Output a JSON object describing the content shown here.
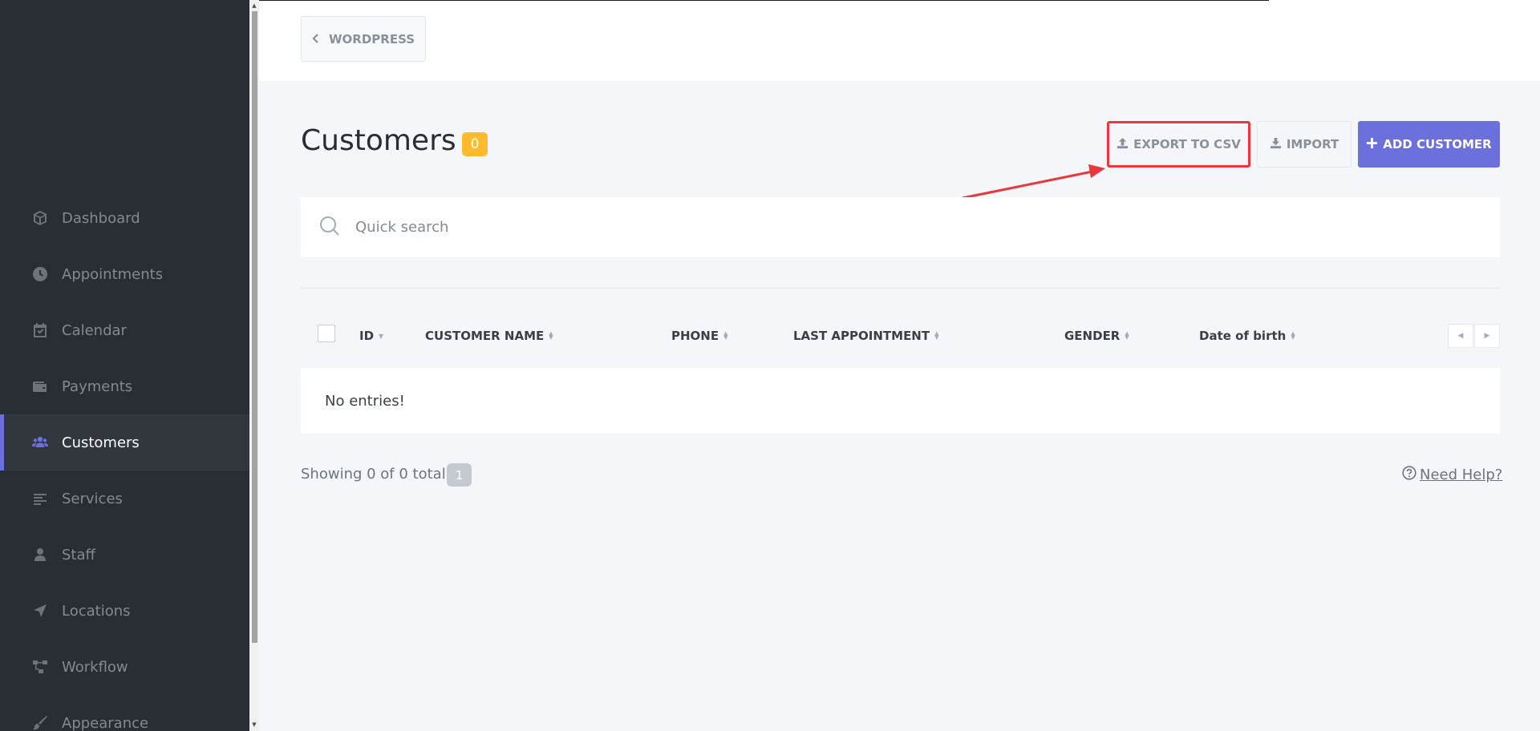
{
  "sidebar": {
    "items": [
      {
        "label": "Dashboard",
        "icon": "box-icon"
      },
      {
        "label": "Appointments",
        "icon": "clock-icon"
      },
      {
        "label": "Calendar",
        "icon": "calendar-icon"
      },
      {
        "label": "Payments",
        "icon": "wallet-icon"
      },
      {
        "label": "Customers",
        "icon": "users-icon",
        "active": true
      },
      {
        "label": "Services",
        "icon": "list-icon"
      },
      {
        "label": "Staff",
        "icon": "user-icon"
      },
      {
        "label": "Locations",
        "icon": "location-arrow-icon"
      },
      {
        "label": "Workflow",
        "icon": "workflow-icon"
      },
      {
        "label": "Appearance",
        "icon": "brush-icon"
      }
    ]
  },
  "topbar": {
    "wordpress_label": "WORDPRESS"
  },
  "page": {
    "title": "Customers",
    "count": "0"
  },
  "actions": {
    "export_label": "EXPORT TO CSV",
    "import_label": "IMPORT",
    "add_label": "ADD CUSTOMER"
  },
  "search": {
    "placeholder": "Quick search"
  },
  "table": {
    "columns": [
      "ID",
      "CUSTOMER NAME",
      "PHONE",
      "LAST APPOINTMENT",
      "GENDER",
      "Date of birth"
    ],
    "empty_text": "No entries!"
  },
  "footer": {
    "showing_text": "Showing 0 of 0 total",
    "page": "1",
    "help_label": "Need Help?"
  },
  "colors": {
    "accent": "#6c70dc",
    "badge": "#ffbb2c",
    "sidebar_bg": "#292d34",
    "annotation": "#e8383c"
  }
}
